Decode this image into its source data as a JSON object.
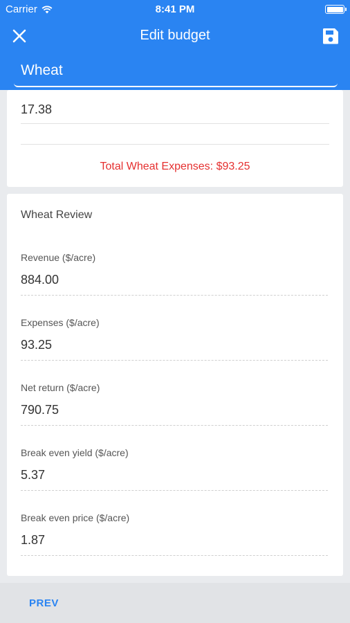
{
  "status_bar": {
    "carrier": "Carrier",
    "time": "8:41 PM"
  },
  "header": {
    "title": "Edit budget",
    "crop_name": "Wheat"
  },
  "expenses_card": {
    "last_value": "17.38",
    "total_label": "Total Wheat Expenses: $93.25"
  },
  "review": {
    "title": "Wheat Review",
    "fields": [
      {
        "label": "Revenue ($/acre)",
        "value": "884.00"
      },
      {
        "label": "Expenses ($/acre)",
        "value": "93.25"
      },
      {
        "label": "Net return ($/acre)",
        "value": "790.75"
      },
      {
        "label": "Break even yield ($/acre)",
        "value": "5.37"
      },
      {
        "label": "Break even price ($/acre)",
        "value": "1.87"
      }
    ]
  },
  "footer": {
    "prev_label": "PREV"
  },
  "colors": {
    "accent": "#2a84f2",
    "total_expenses": "#e53030",
    "background": "#e9ebee"
  },
  "icons": {
    "close": "close-icon",
    "save": "floppy-disk-icon",
    "wifi": "wifi-icon",
    "battery": "battery-icon"
  }
}
